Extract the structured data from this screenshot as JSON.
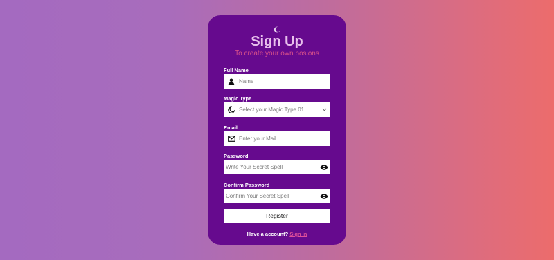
{
  "form": {
    "title": "Sign Up",
    "subtitle": "To create your own posions",
    "full_name_label": "Full Name",
    "full_name_placeholder": "Name",
    "magic_type_label": "Magic Type",
    "magic_type_value": "Select your Magic Type 01",
    "email_label": "Email",
    "email_placeholder": "Enter your Mail",
    "password_label": "Password",
    "password_placeholder": "Write Your Secret Spell",
    "confirm_label": "Confirm Password",
    "confirm_placeholder": "Confirm Your Secret Spell",
    "register_label": "Register",
    "have_account_text": "Have a account?",
    "sign_in_label": "Sign in"
  },
  "icons": [
    "moon-icon",
    "user-icon",
    "moon-icon",
    "chevron-down-icon",
    "envelope-icon",
    "eye-icon"
  ],
  "colors": {
    "card": "#660a8e",
    "title": "#e8c0ec",
    "subtitle": "#d8508a",
    "link": "#e0509a"
  }
}
